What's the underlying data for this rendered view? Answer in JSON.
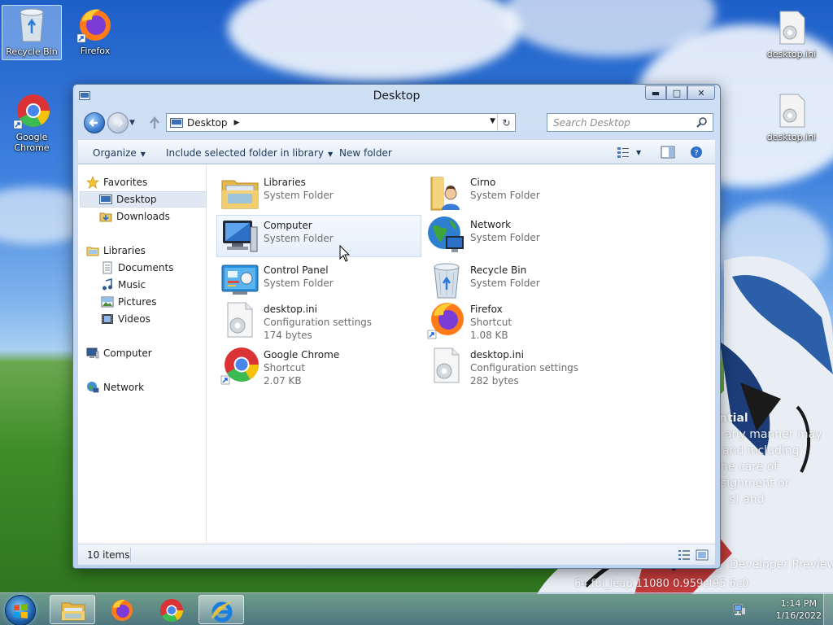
{
  "desktop": {
    "icons": [
      {
        "label": "Recycle Bin",
        "icon": "recycle-bin-icon"
      },
      {
        "label": "Firefox",
        "icon": "firefox-icon"
      },
      {
        "label": "Google Chrome",
        "icon": "chrome-icon"
      },
      {
        "label": "desktop.ini",
        "icon": "settings-file-icon"
      },
      {
        "label": "desktop.ini",
        "icon": "settings-file-icon"
      }
    ],
    "wallpaper_text": [
      "ntial",
      "any manner may",
      "and including",
      "he care of",
      "signment or",
      "s) and",
      "Developer Preview",
      "64.fbl_leap.11080      0.959cf95      6c0"
    ]
  },
  "window": {
    "title": "Desktop",
    "controls": {
      "minimize": "▬",
      "maximize": "□",
      "close": "✕"
    },
    "address": {
      "location": "Desktop",
      "separator": "▶",
      "dropdown": "▼",
      "refresh": "↻"
    },
    "search": {
      "placeholder": "Search Desktop",
      "value": ""
    },
    "commands": {
      "organize": "Organize",
      "include_in_library": "Include selected folder in library",
      "new_folder": "New folder",
      "caret": "▼"
    },
    "nav": {
      "favorites": "Favorites",
      "desktop": "Desktop",
      "downloads": "Downloads",
      "libraries": "Libraries",
      "documents": "Documents",
      "music": "Music",
      "pictures": "Pictures",
      "videos": "Videos",
      "computer": "Computer",
      "network": "Network"
    },
    "items": [
      {
        "name": "Libraries",
        "line2": "System Folder",
        "line3": "",
        "icon": "libraries-folder-icon"
      },
      {
        "name": "Cirno",
        "line2": "System Folder",
        "line3": "",
        "icon": "user-folder-icon"
      },
      {
        "name": "Computer",
        "line2": "System Folder",
        "line3": "",
        "icon": "computer-icon"
      },
      {
        "name": "Network",
        "line2": "System Folder",
        "line3": "",
        "icon": "network-globe-icon"
      },
      {
        "name": "Control Panel",
        "line2": "System Folder",
        "line3": "",
        "icon": "control-panel-icon"
      },
      {
        "name": "Recycle Bin",
        "line2": "System Folder",
        "line3": "",
        "icon": "recycle-bin-icon"
      },
      {
        "name": "desktop.ini",
        "line2": "Configuration settings",
        "line3": "174 bytes",
        "icon": "settings-file-icon"
      },
      {
        "name": "Firefox",
        "line2": "Shortcut",
        "line3": "1.08 KB",
        "icon": "firefox-icon"
      },
      {
        "name": "Google Chrome",
        "line2": "Shortcut",
        "line3": "2.07 KB",
        "icon": "chrome-icon"
      },
      {
        "name": "desktop.ini",
        "line2": "Configuration settings",
        "line3": "282 bytes",
        "icon": "settings-file-icon"
      }
    ],
    "status": {
      "item_count": "10 items"
    }
  },
  "taskbar": {
    "pinned": [
      "explorer-icon",
      "firefox-icon",
      "chrome-icon",
      "internet-explorer-icon"
    ],
    "clock": {
      "time": "1:14 PM",
      "date": "1/16/2022"
    }
  },
  "colors": {
    "accent": "#3f82de",
    "selection": "#e0e8f3",
    "window_frame": "#bcd2ee"
  }
}
